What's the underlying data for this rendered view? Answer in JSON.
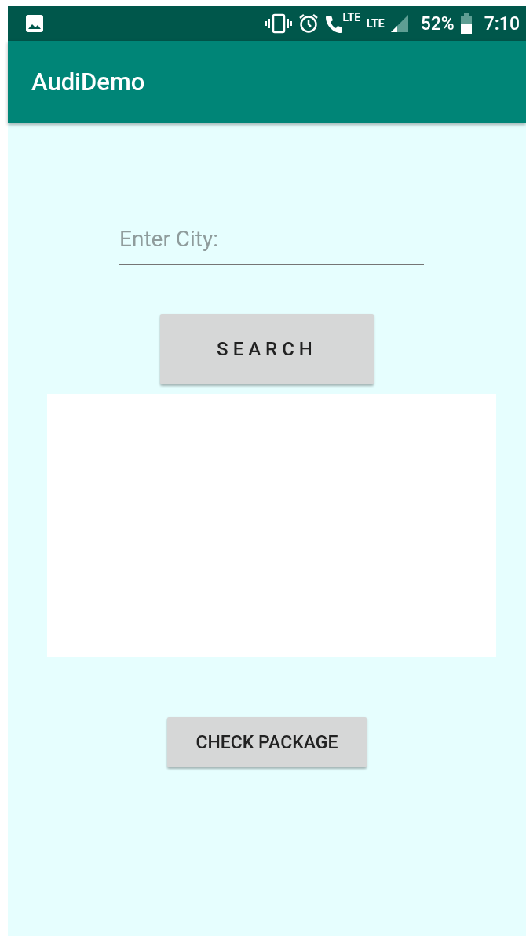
{
  "status_bar": {
    "call_network": "LTE",
    "network": "LTE",
    "battery": "52%",
    "time": "7:10"
  },
  "app_bar": {
    "title": "AudiDemo"
  },
  "city_field": {
    "placeholder": "Enter City:"
  },
  "buttons": [
    {
      "label": "SEARCH",
      "kind": "spaced"
    },
    {
      "label": "CHECK PACKAGE",
      "kind": "plain"
    }
  ]
}
